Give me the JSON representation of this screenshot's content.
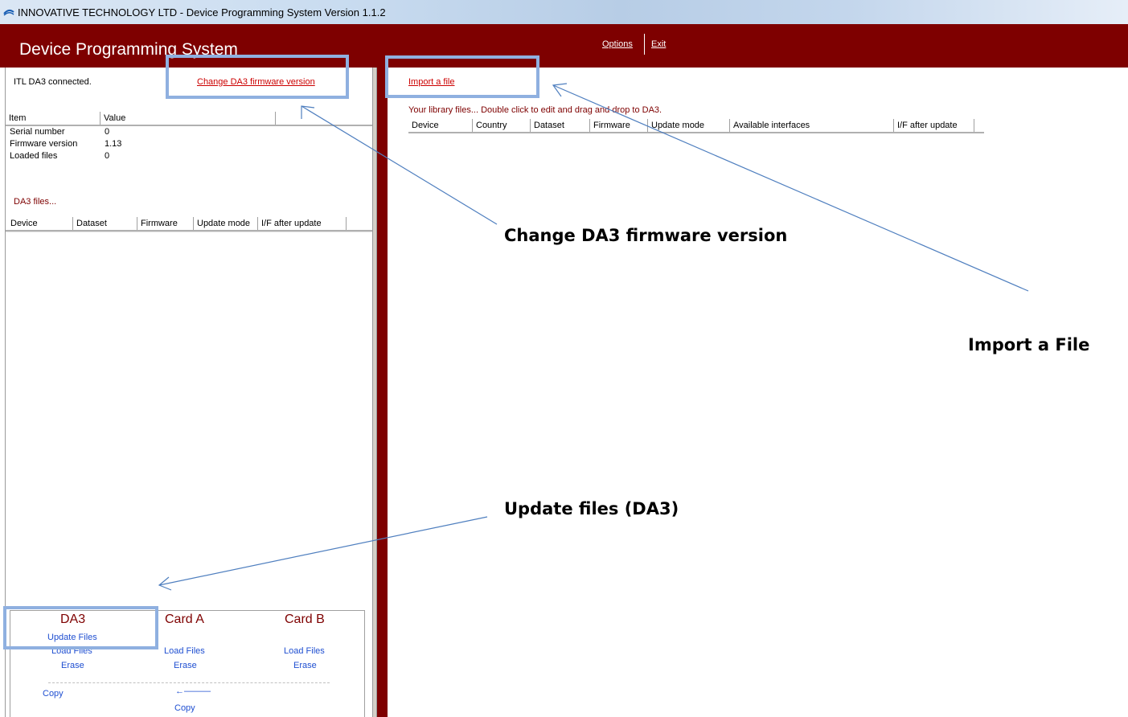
{
  "window": {
    "title": "INNOVATIVE TECHNOLOGY LTD  -  Device Programming System  Version 1.1.2"
  },
  "header": {
    "title": "Device Programming System",
    "options": "Options",
    "exit": "Exit"
  },
  "left": {
    "status": "ITL DA3 connected.",
    "change_firmware_link": "Change DA3 firmware version",
    "info_columns": [
      "Item",
      "Value"
    ],
    "info_rows": [
      {
        "item": "Serial number",
        "value": "0"
      },
      {
        "item": "Firmware version",
        "value": "1.13"
      },
      {
        "item": "Loaded files",
        "value": "0"
      }
    ],
    "files_label": "DA3 files...",
    "files_columns": [
      "Device",
      "Dataset",
      "Firmware",
      "Update mode",
      "I/F after update"
    ]
  },
  "cards": {
    "da3": {
      "title": "DA3",
      "update": "Update Files",
      "load": "Load Files",
      "erase": "Erase"
    },
    "card_a": {
      "title": "Card A",
      "load": "Load Files",
      "erase": "Erase"
    },
    "card_b": {
      "title": "Card B",
      "load": "Load Files",
      "erase": "Erase"
    },
    "copy_left": "Copy",
    "arrow": "←———",
    "copy_right": "Copy"
  },
  "right": {
    "import_link": "Import a file",
    "library_label": "Your library files...  Double click to edit and drag and drop to DA3.",
    "library_columns": [
      "Device",
      "Country",
      "Dataset",
      "Firmware",
      "Update mode",
      "Available interfaces",
      "I/F after update"
    ]
  },
  "callouts": {
    "change_firmware": "Change DA3 firmware version",
    "import_file": "Import a File",
    "update_files": "Update files (DA3)"
  },
  "colors": {
    "brand": "#7e0000",
    "link_red": "#cc0000",
    "link_blue": "#1f4fd1",
    "highlight": "#8fb0e0"
  }
}
